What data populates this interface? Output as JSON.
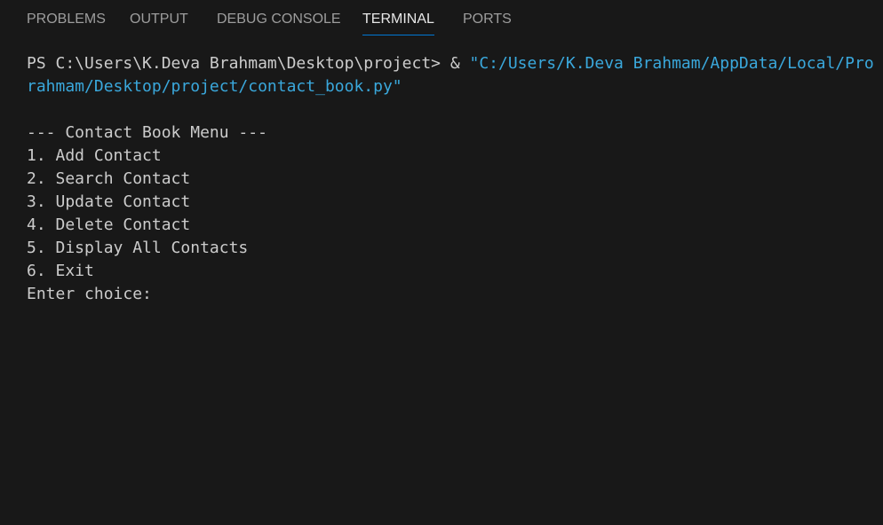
{
  "tabs": [
    {
      "label": "PROBLEMS"
    },
    {
      "label": "OUTPUT"
    },
    {
      "label": "DEBUG CONSOLE"
    },
    {
      "label": "TERMINAL"
    },
    {
      "label": "PORTS"
    }
  ],
  "active_tab": "TERMINAL",
  "terminal": {
    "prompt": "PS C:\\Users\\K.Deva Brahmam\\Desktop\\project> & ",
    "command_string": "\"C:/Users/K.Deva Brahmam/AppData/Local/Pro",
    "command_continuation": "rahmam/Desktop/project/contact_book.py\"",
    "menu_title": "--- Contact Book Menu ---",
    "menu_items": [
      "1. Add Contact",
      "2. Search Contact",
      "3. Update Contact",
      "4. Delete Contact",
      "5. Display All Contacts",
      "6. Exit"
    ],
    "input_prompt": "Enter choice: "
  },
  "colors": {
    "background": "#181818",
    "text": "#cccccc",
    "string": "#3aa8dc",
    "tab_inactive": "#9d9d9d",
    "tab_active": "#e7e7e7",
    "accent": "#0078d4"
  }
}
